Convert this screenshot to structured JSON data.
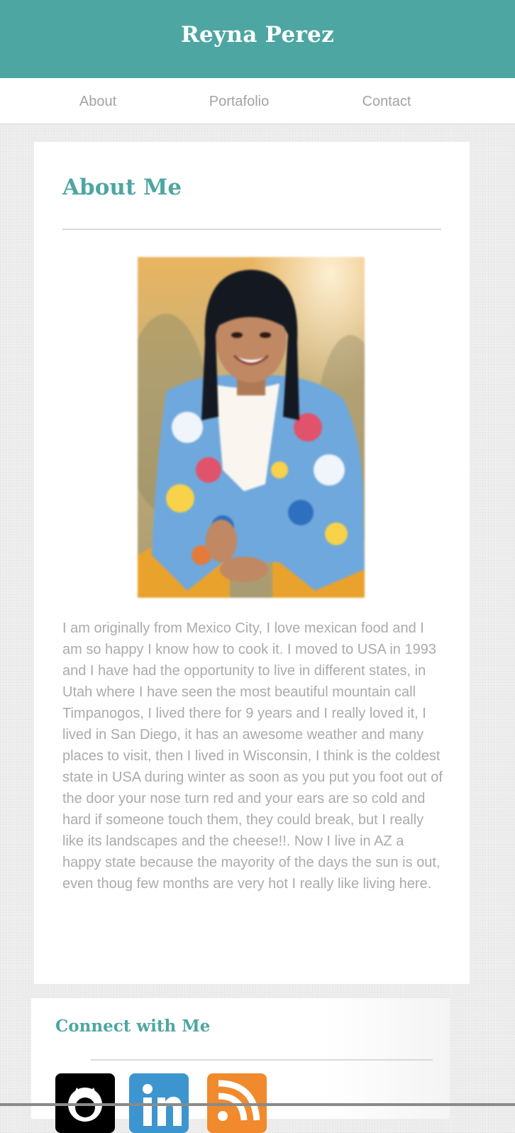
{
  "header": {
    "title": "Reyna Perez"
  },
  "nav": {
    "items": [
      {
        "label": "About"
      },
      {
        "label": "Portafolio"
      },
      {
        "label": "Contact"
      }
    ]
  },
  "about": {
    "heading": "About Me",
    "photo_icon": "portrait-photo",
    "bio": "I am originally from Mexico City, I love mexican food and I am so happy I know how to cook it. I moved to USA in 1993 and I have had the opportunity to live in different states, in Utah where I have seen the most beautiful mountain call Timpanogos, I lived there for 9 years and I really loved it, I lived in San Diego, it has an awesome weather and many places to visit, then I lived in Wisconsin, I think is the coldest state in USA during winter as soon as you put you foot out of the door your nose turn red and your ears are so cold and hard if someone touch them, they could break, but I really like its landscapes and the cheese!!. Now I live in AZ a happy state because the mayority of the days the sun is out, even thoug few months are very hot I really like living here."
  },
  "connect": {
    "heading": "Connect with Me",
    "social": [
      {
        "icon": "github-icon",
        "color": "#000000"
      },
      {
        "icon": "linkedin-icon",
        "color": "#3d95cf"
      },
      {
        "icon": "rss-icon",
        "color": "#f08a2c"
      }
    ]
  },
  "colors": {
    "accent": "#4ea6a2",
    "nav_text": "#a3a3a3",
    "body_text": "#ababab"
  }
}
